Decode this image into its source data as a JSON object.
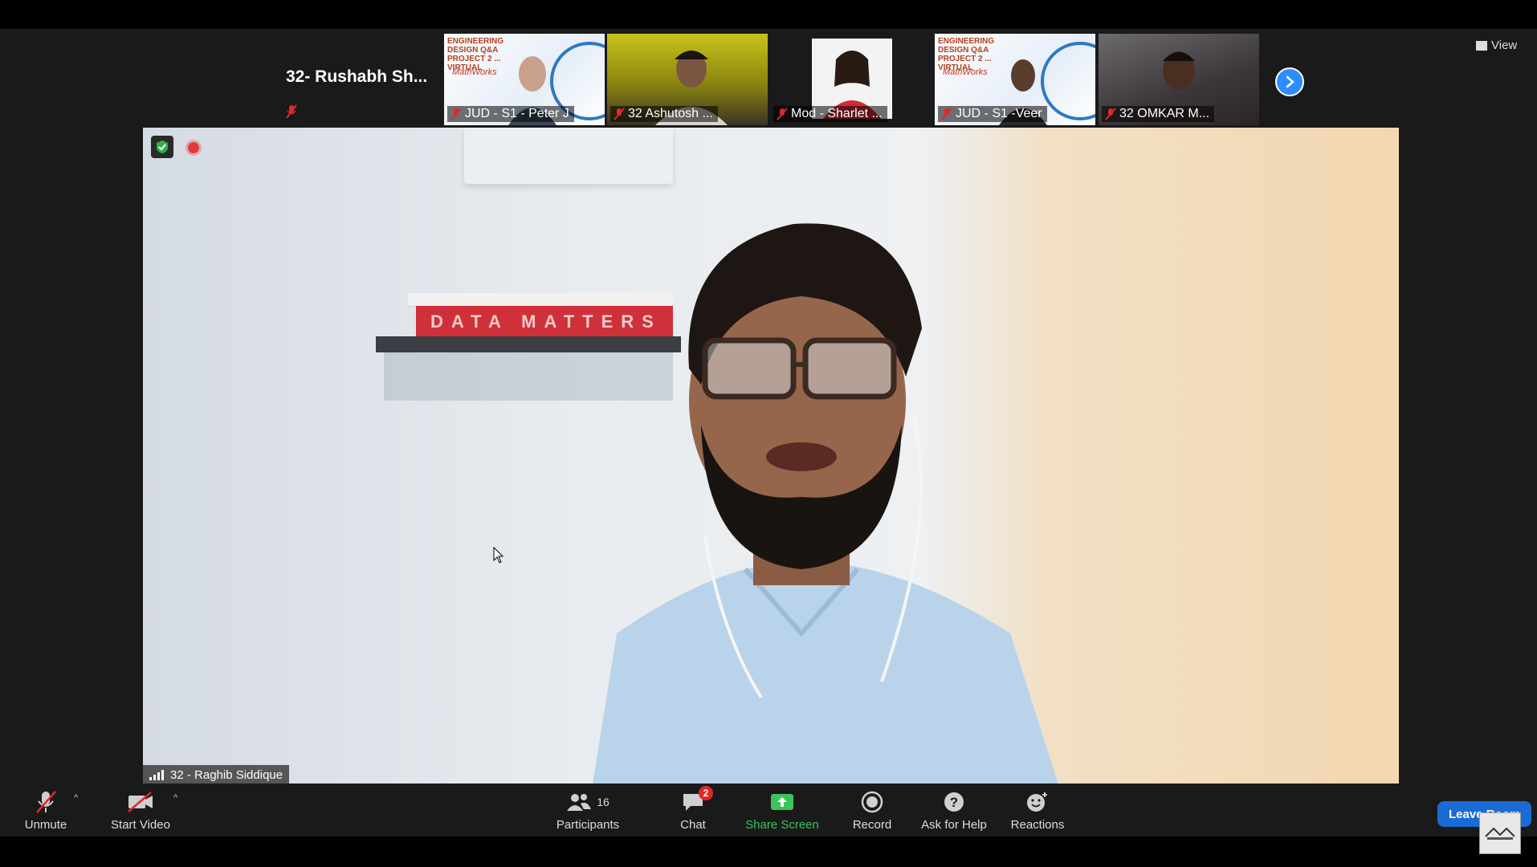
{
  "strip": {
    "name_only_tile": {
      "name": "32- Rushabh Sh..."
    },
    "tiles": [
      {
        "name": "JUD - S1 - Peter J",
        "banner": true,
        "banner_title": "ENGINEERING DESIGN Q&A PROJECT 2 ... VIRTUAL",
        "banner_logo": "MathWorks"
      },
      {
        "name": "32 Ashutosh ...",
        "banner": false
      },
      {
        "name": "Mod - Sharlet ...",
        "banner": false
      },
      {
        "name": "JUD - S1 -Veer",
        "banner": true,
        "banner_title": "ENGINEERING DESIGN Q&A PROJECT 2 ... VIRTUAL",
        "banner_logo": "MathWorks"
      },
      {
        "name": "32 OMKAR M...",
        "banner": false
      }
    ],
    "next_icon": "chevron-right-icon"
  },
  "view": {
    "label": "View"
  },
  "main": {
    "speaker_name": "32 - Raghib Siddique",
    "book_text": "DATA MATTERS"
  },
  "toolbar": {
    "unmute": "Unmute",
    "start_video": "Start Video",
    "participants": "Participants",
    "participants_count": "16",
    "chat": "Chat",
    "chat_badge": "2",
    "share_screen": "Share Screen",
    "record": "Record",
    "ask_for_help": "Ask for Help",
    "reactions": "Reactions",
    "leave_room": "Leave Room"
  },
  "colors": {
    "accent_blue": "#2d8cff",
    "share_green": "#3cc35b",
    "mute_red": "#e02828",
    "leave_blue": "#1b6bd6"
  }
}
